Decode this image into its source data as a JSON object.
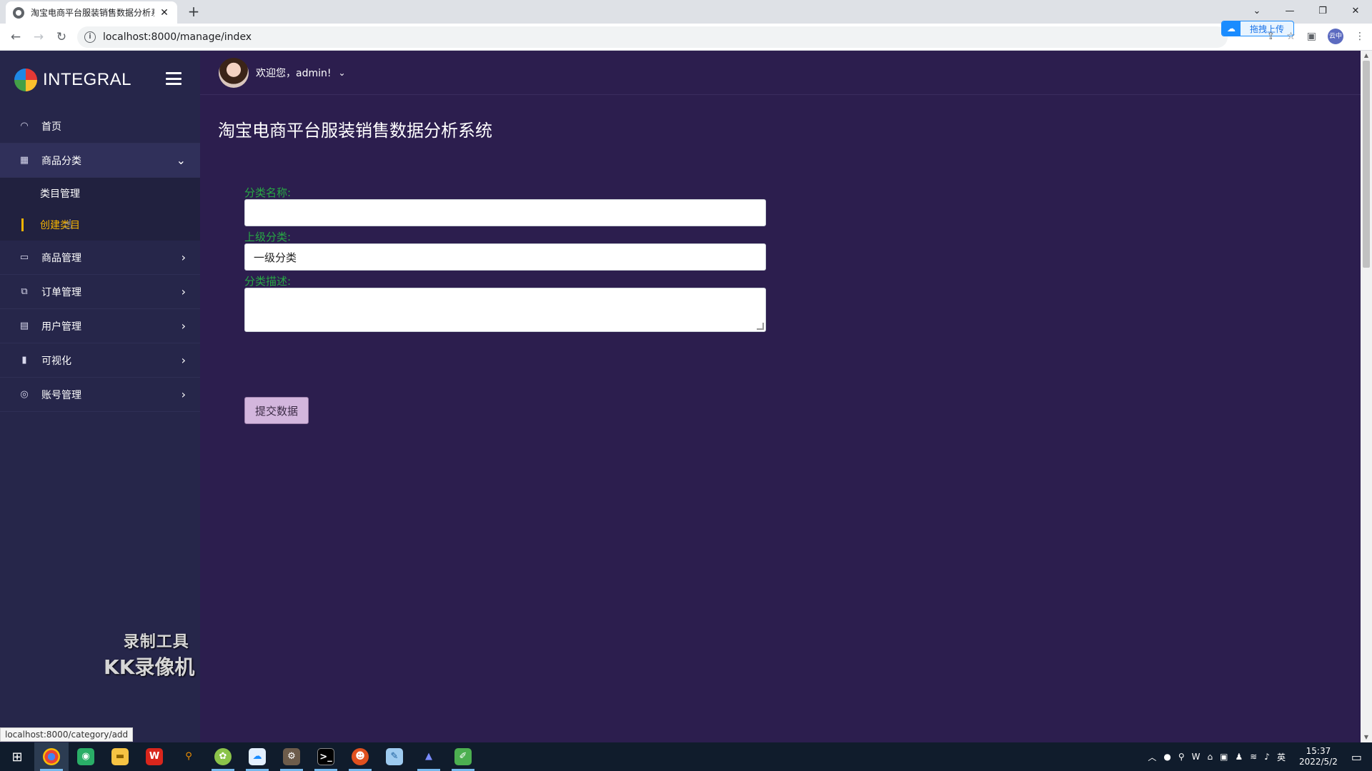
{
  "browser": {
    "tab_title": "淘宝电商平台服装销售数据分析系",
    "url": "localhost:8000/manage/index",
    "upload_label": "拖拽上传",
    "profile_label": "云中",
    "status_url": "localhost:8000/category/add"
  },
  "sidebar": {
    "brand": "INTEGRAL",
    "items": [
      {
        "label": "首页",
        "icon": "dashboard-icon"
      },
      {
        "label": "商品分类",
        "icon": "grid-icon",
        "expanded": true,
        "children": [
          {
            "label": "类目管理"
          },
          {
            "label": "创建类目",
            "current": true
          }
        ]
      },
      {
        "label": "商品管理",
        "icon": "window-icon"
      },
      {
        "label": "订单管理",
        "icon": "copy-icon"
      },
      {
        "label": "用户管理",
        "icon": "document-icon"
      },
      {
        "label": "可视化",
        "icon": "bar-chart-icon"
      },
      {
        "label": "账号管理",
        "icon": "globe-icon"
      }
    ],
    "watermark_line1": "录制工具",
    "watermark_line2": "KK录像机"
  },
  "topbar": {
    "greeting": "欢迎您，admin!"
  },
  "main": {
    "title": "淘宝电商平台服装销售数据分析系统",
    "form": {
      "name_label": "分类名称:",
      "name_value": "",
      "parent_label": "上级分类:",
      "parent_value": "一级分类",
      "desc_label": "分类描述:",
      "desc_value": "",
      "submit_label": "提交数据"
    }
  },
  "taskbar": {
    "time": "15:37",
    "date": "2022/5/2",
    "ime": "英"
  },
  "colors": {
    "sidebar_bg": "#26264a",
    "content_bg": "#2c1e4e",
    "label_green": "#27a844",
    "current_item": "#f5b400",
    "submit_bg": "#d3b6dd"
  }
}
